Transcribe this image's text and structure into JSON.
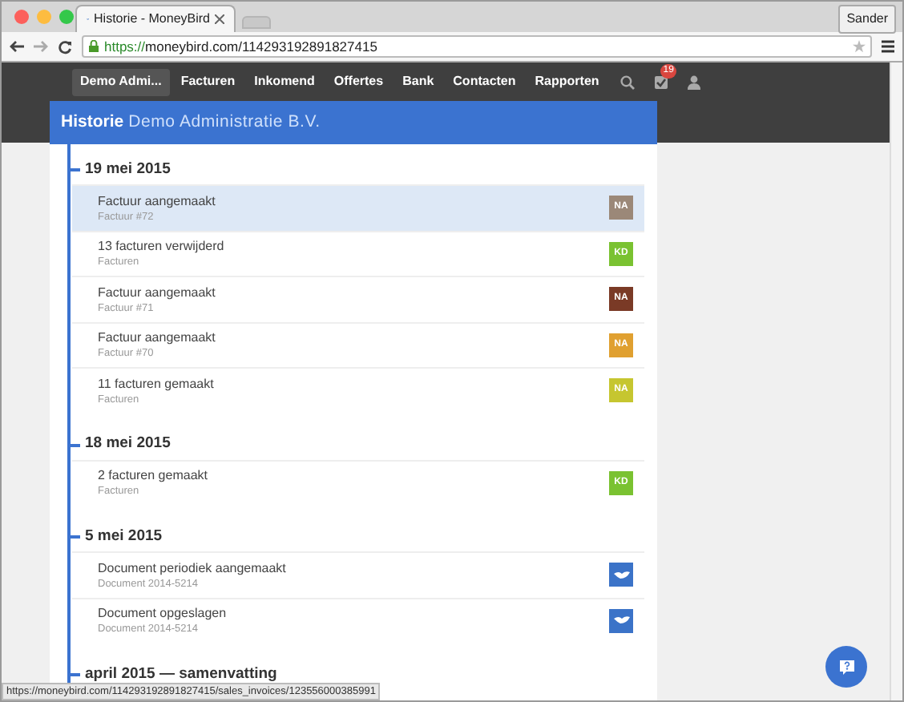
{
  "browser": {
    "tab_title": "Historie - MoneyBird",
    "user": "Sander",
    "url_scheme": "https://",
    "url_rest": "moneybird.com/114293192891827415",
    "status_url": "https://moneybird.com/114293192891827415/sales_invoices/123556000385991"
  },
  "nav": {
    "items": [
      {
        "label": "Demo Admi...",
        "selected": true
      },
      {
        "label": "Facturen",
        "selected": false
      },
      {
        "label": "Inkomend",
        "selected": false
      },
      {
        "label": "Offertes",
        "selected": false
      },
      {
        "label": "Bank",
        "selected": false
      },
      {
        "label": "Contacten",
        "selected": false
      },
      {
        "label": "Rapporten",
        "selected": false
      }
    ],
    "badge": "19"
  },
  "header": {
    "title": "Historie",
    "subtitle": "Demo Administratie B.V."
  },
  "groups": [
    {
      "date": "19 mei 2015",
      "entries": [
        {
          "title": "Factuur aangemaakt",
          "subtitle": "Factuur #72",
          "kind": "avatar",
          "initials": "NA",
          "color": "#9b8878",
          "selected": true
        },
        {
          "title": "13 facturen verwijderd",
          "subtitle": "Facturen",
          "kind": "avatar",
          "initials": "KD",
          "color": "#7ac231",
          "selected": false
        },
        {
          "title": "Factuur aangemaakt",
          "subtitle": "Factuur #71",
          "kind": "avatar",
          "initials": "NA",
          "color": "#7a3a26",
          "selected": false
        },
        {
          "title": "Factuur aangemaakt",
          "subtitle": "Factuur #70",
          "kind": "avatar",
          "initials": "NA",
          "color": "#e0a030",
          "selected": false
        },
        {
          "title": "11 facturen gemaakt",
          "subtitle": "Facturen",
          "kind": "avatar",
          "initials": "NA",
          "color": "#c6c630",
          "selected": false
        }
      ]
    },
    {
      "date": "18 mei 2015",
      "entries": [
        {
          "title": "2 facturen gemaakt",
          "subtitle": "Facturen",
          "kind": "avatar",
          "initials": "KD",
          "color": "#7ac231",
          "selected": false
        }
      ]
    },
    {
      "date": "5 mei 2015",
      "entries": [
        {
          "title": "Document periodiek aangemaakt",
          "subtitle": "Document 2014-5214",
          "kind": "logo",
          "color": "#3b73c8",
          "selected": false
        },
        {
          "title": "Document opgeslagen",
          "subtitle": "Document 2014-5214",
          "kind": "logo",
          "color": "#3b73c8",
          "selected": false
        }
      ]
    },
    {
      "date": "april 2015 — samenvatting"
    }
  ]
}
